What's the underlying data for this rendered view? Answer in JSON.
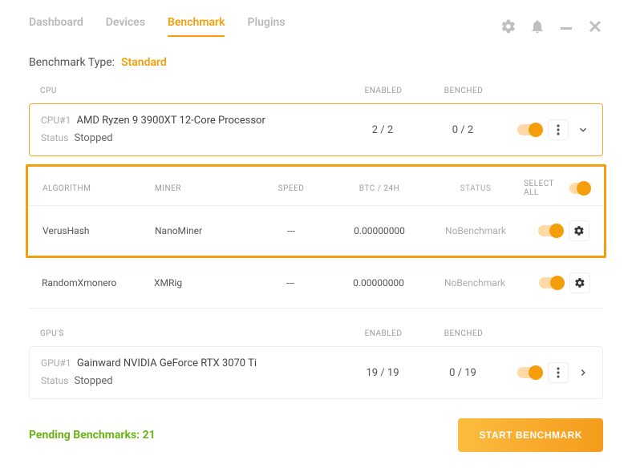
{
  "tabs": {
    "dashboard": "Dashboard",
    "devices": "Devices",
    "benchmark": "Benchmark",
    "plugins": "Plugins"
  },
  "benchType": {
    "label": "Benchmark Type:",
    "value": "Standard"
  },
  "cpu": {
    "sectionLabel": "CPU",
    "enabledLabel": "ENABLED",
    "benchedLabel": "BENCHED",
    "idLabel": "CPU#1",
    "name": "AMD Ryzen 9 3900XT 12-Core Processor",
    "statusLabel": "Status",
    "status": "Stopped",
    "enabled": "2 / 2",
    "benched": "0 / 2"
  },
  "algoHeader": {
    "algorithm": "ALGORITHM",
    "miner": "MINER",
    "speed": "SPEED",
    "btc": "BTC / 24H",
    "status": "STATUS",
    "selectAll": "SELECT ALL"
  },
  "algoRows": [
    {
      "algorithm": "VerusHash",
      "miner": "NanoMiner",
      "speed": "---",
      "btc": "0.00000000",
      "status": "NoBenchmark"
    },
    {
      "algorithm": "RandomXmonero",
      "miner": "XMRig",
      "speed": "---",
      "btc": "0.00000000",
      "status": "NoBenchmark"
    }
  ],
  "gpu": {
    "sectionLabel": "GPU'S",
    "enabledLabel": "ENABLED",
    "benchedLabel": "BENCHED",
    "idLabel": "GPU#1",
    "name": "Gainward NVIDIA GeForce RTX 3070 Ti",
    "statusLabel": "Status",
    "status": "Stopped",
    "enabled": "19 / 19",
    "benched": "0 / 19"
  },
  "footer": {
    "pending": "Pending Benchmarks: 21",
    "startBtn": "START BENCHMARK"
  }
}
